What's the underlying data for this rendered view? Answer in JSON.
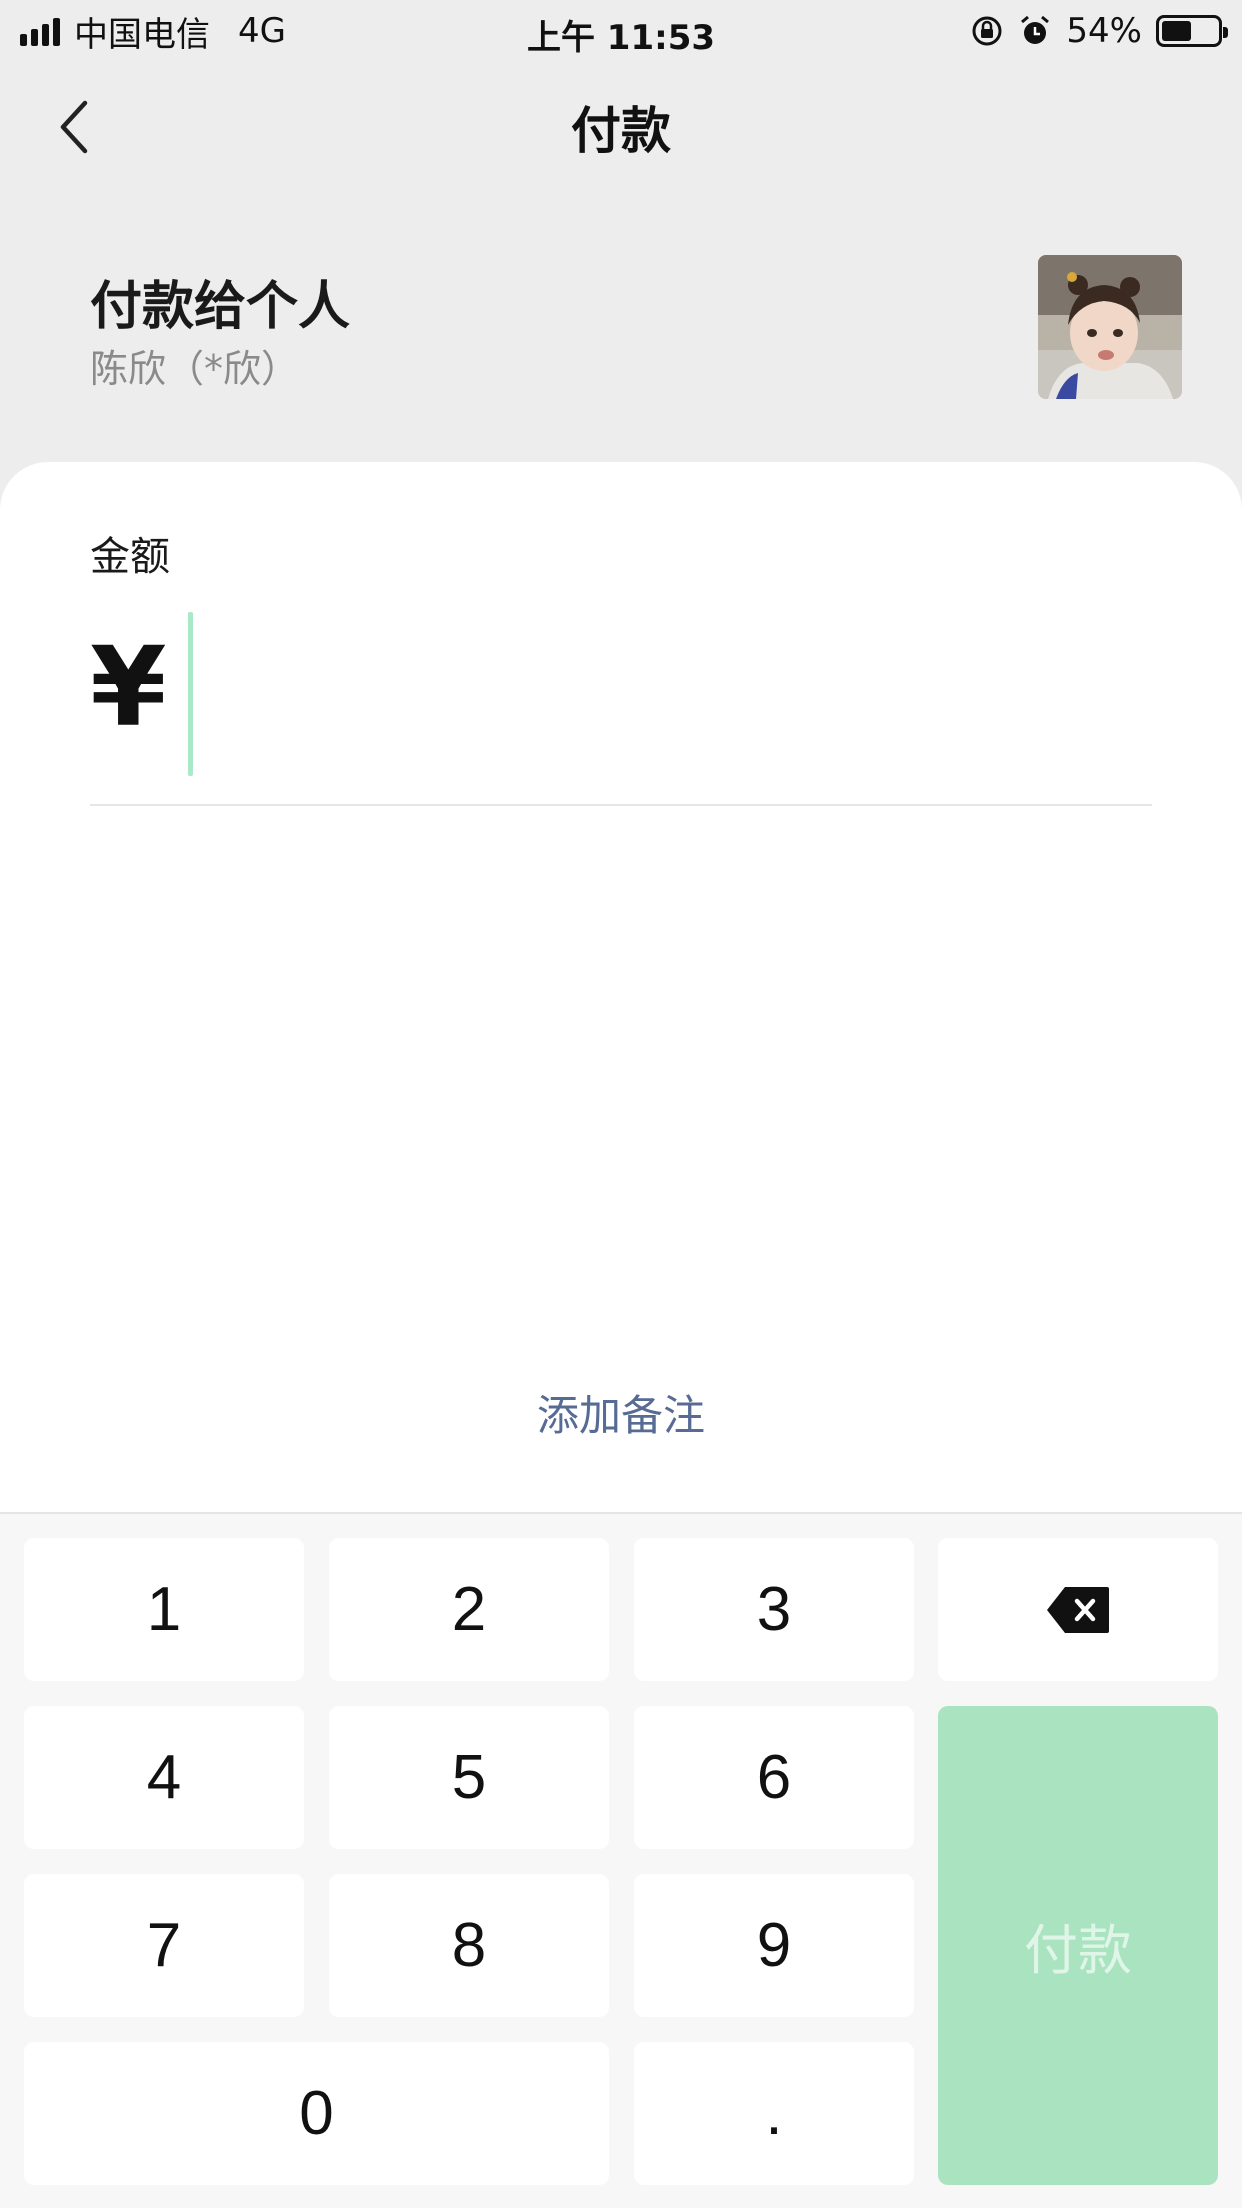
{
  "status_bar": {
    "carrier": "中国电信",
    "network": "4G",
    "time": "上午 11:53",
    "battery": "54%",
    "battery_level": 0.54
  },
  "nav": {
    "title": "付款"
  },
  "payee": {
    "title": "付款给个人",
    "name": "陈欣（*欣）"
  },
  "amount": {
    "label": "金额",
    "currency": "¥",
    "value": ""
  },
  "add_note": "添加备注",
  "keypad": {
    "k1": "1",
    "k2": "2",
    "k3": "3",
    "k4": "4",
    "k5": "5",
    "k6": "6",
    "k7": "7",
    "k8": "8",
    "k9": "9",
    "k0": "0",
    "dot": ".",
    "pay": "付款"
  },
  "colors": {
    "accent_green": "#07c160",
    "pay_button_disabled": "#aae3c0",
    "link_blue": "#576b95"
  },
  "icons": {
    "back": "chevron-left-icon",
    "delete": "backspace-icon",
    "lock_rotation": "rotation-lock-icon",
    "alarm": "alarm-icon"
  }
}
